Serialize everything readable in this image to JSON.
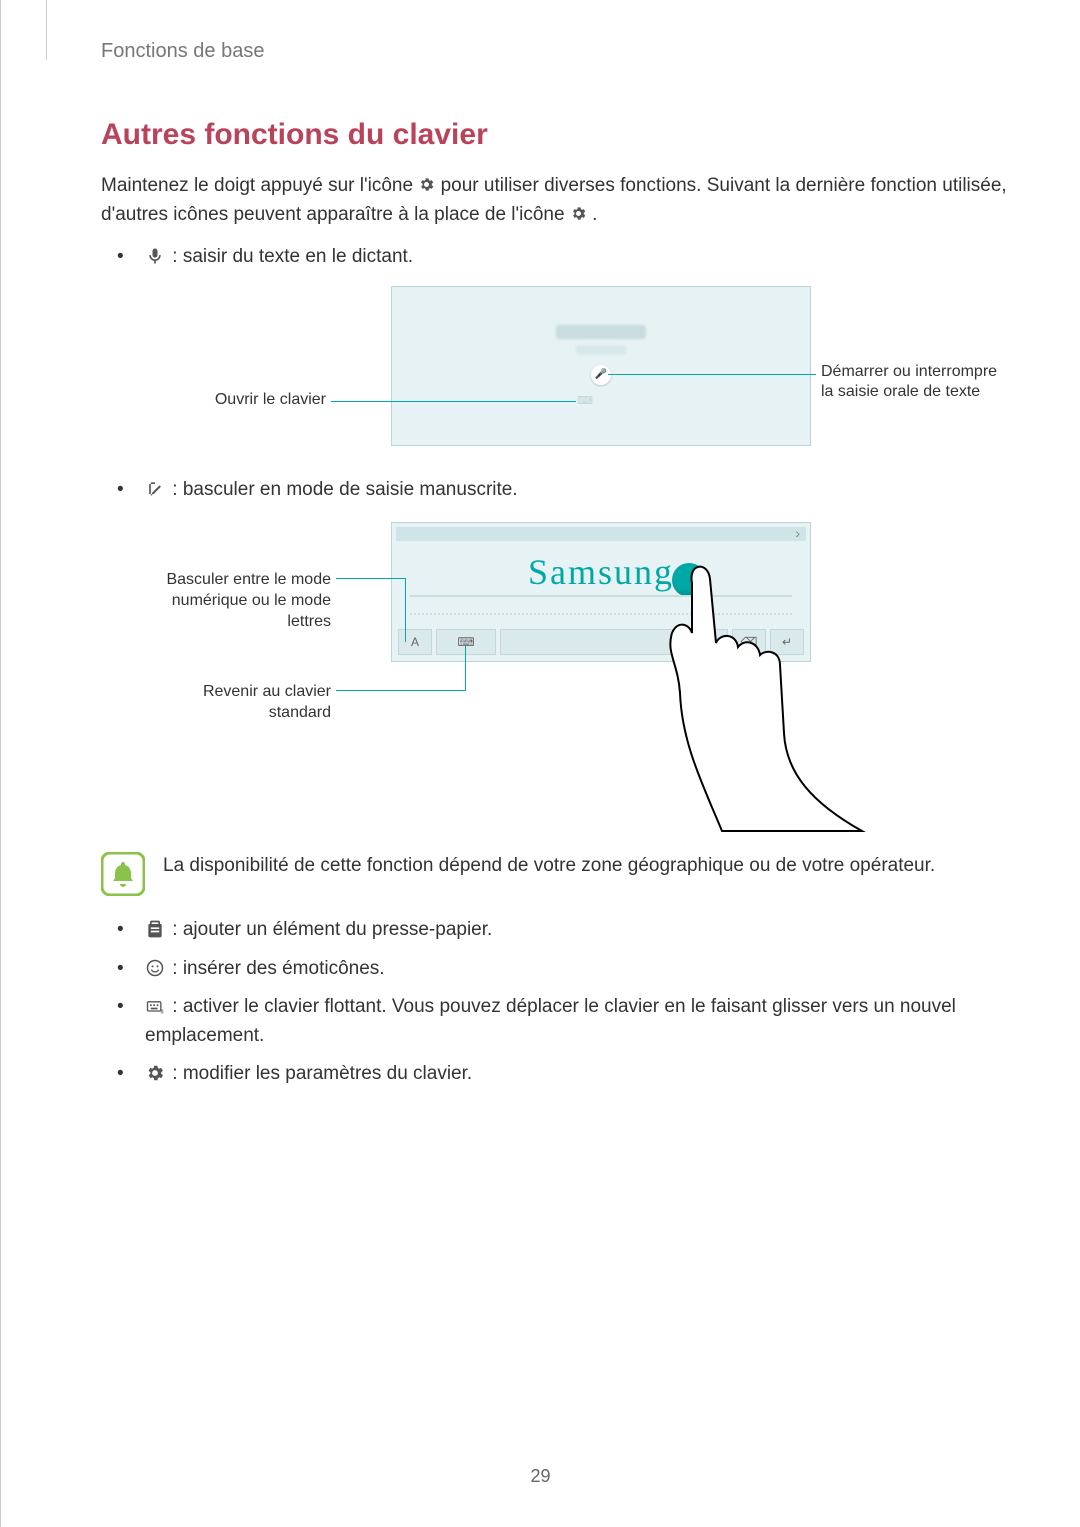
{
  "breadcrumb": "Fonctions de base",
  "title": "Autres fonctions du clavier",
  "intro_part1": "Maintenez le doigt appuyé sur l'icône ",
  "intro_part2": " pour utiliser diverses fonctions. Suivant la dernière fonction utilisée, d'autres icônes peuvent apparaître à la place de l'icône ",
  "intro_part3": ".",
  "bullet_mic": " : saisir du texte en le dictant.",
  "fig1": {
    "left": "Ouvrir le clavier",
    "right": "Démarrer ou interrompre la saisie orale de texte"
  },
  "bullet_pen": " : basculer en mode de saisie manuscrite.",
  "fig2": {
    "left1": "Basculer entre le mode numérique ou le mode lettres",
    "left2": "Revenir au clavier standard",
    "sample": "Samsung"
  },
  "note": "La disponibilité de cette fonction dépend de votre zone géographique ou de votre opérateur.",
  "bullet_clip": " : ajouter un élément du presse-papier.",
  "bullet_emoji": " : insérer des émoticônes.",
  "bullet_float": " : activer le clavier flottant. Vous pouvez déplacer le clavier en le faisant glisser vers un nouvel emplacement.",
  "bullet_gear": " : modifier les paramètres du clavier.",
  "page_number": "29"
}
